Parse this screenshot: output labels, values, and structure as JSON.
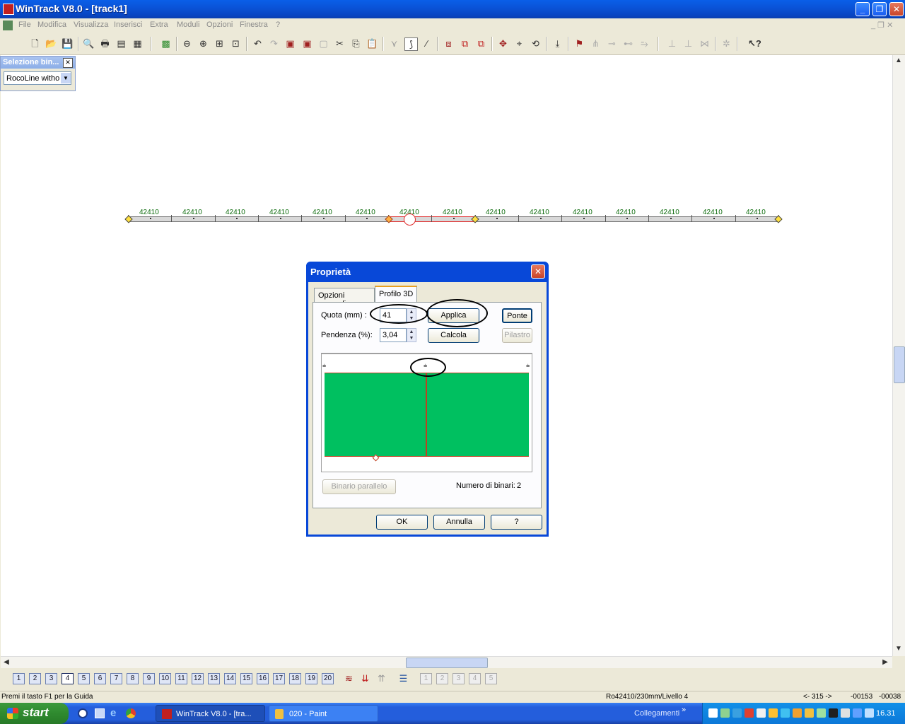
{
  "window": {
    "title": "WinTrack  V8.0 - [track1]"
  },
  "menu": [
    "File",
    "Modifica",
    "Visualizza",
    "Inserisci",
    "Extra",
    "Moduli",
    "Opzioni",
    "Finestra",
    "?"
  ],
  "selector": {
    "title": "Selezione bin...",
    "value": "RocoLine witho"
  },
  "track": {
    "segment_label": "42410",
    "segment_count": 15
  },
  "dialog": {
    "title": "Proprietà",
    "tabs": [
      "Opzioni generali",
      "Profilo 3D"
    ],
    "active_tab": "Profilo 3D",
    "quota_label": "Quota (mm) :",
    "quota_value": "41",
    "pendenza_label": "Pendenza (%):",
    "pendenza_value": "3,04",
    "applica": "Applica",
    "calcola": "Calcola",
    "ponte": "Ponte",
    "pilastro": "Pilastro",
    "binario_parallelo": "Binario parallelo",
    "numero_label": "Numero di binari:",
    "numero_value": "2",
    "ok": "OK",
    "annulla": "Annulla",
    "help": "?",
    "profile_fill_color": "#00c060"
  },
  "levels": [
    "1",
    "2",
    "3",
    "4",
    "5",
    "6",
    "7",
    "8",
    "9",
    "10",
    "11",
    "12",
    "13",
    "14",
    "15",
    "16",
    "17",
    "18",
    "19",
    "20"
  ],
  "status": {
    "hint": "Premi il tasto F1 per la Guida",
    "info": "Ro42410/230mm/Livello 4",
    "angle": "<- 315 ->",
    "x": "-00153",
    "y": "-00038"
  },
  "taskbar": {
    "start": "start",
    "tasks": [
      "WinTrack  V8.0 - [tra...",
      "020 - Paint"
    ],
    "links": "Collegamenti",
    "clock": "16.31"
  }
}
